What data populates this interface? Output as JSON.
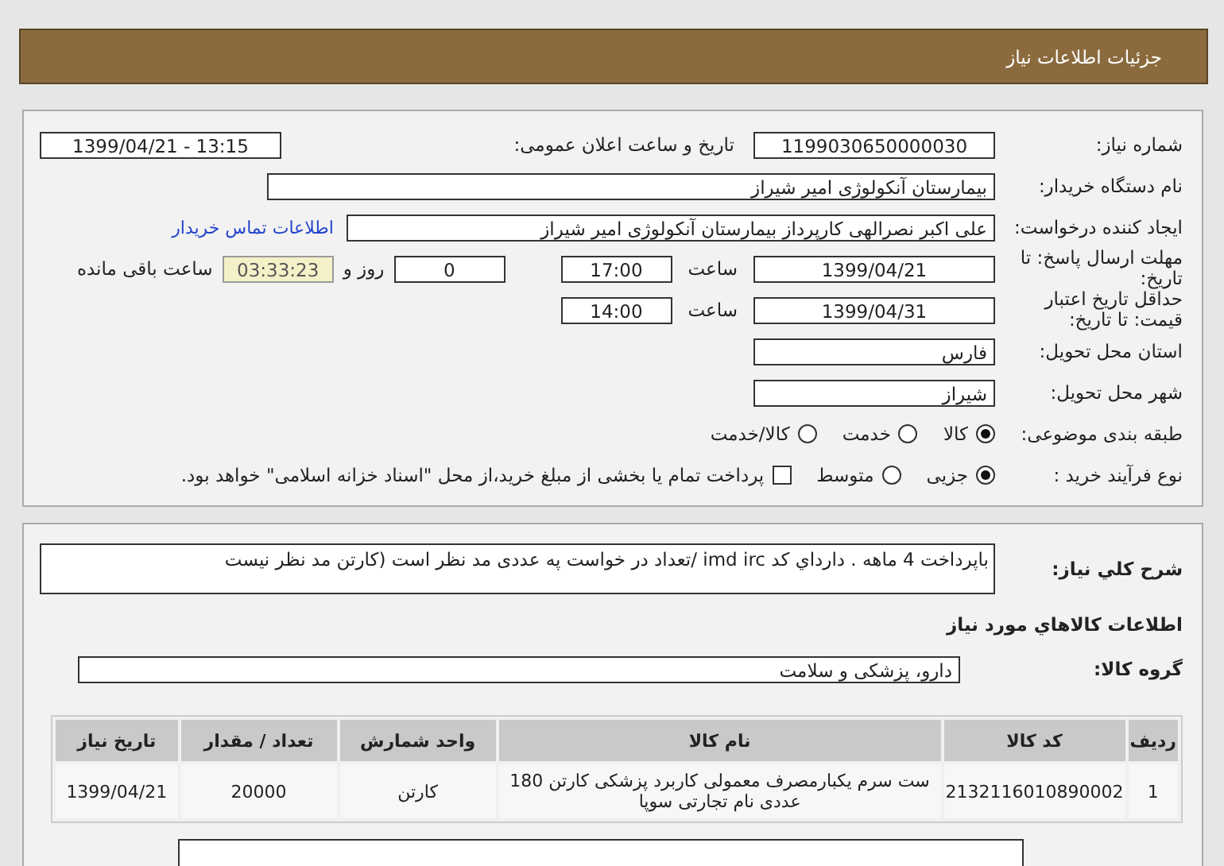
{
  "header": {
    "title": "جزئیات اطلاعات نیاز"
  },
  "need_number": {
    "label": "شماره نیاز:",
    "value": "1199030650000030"
  },
  "announce_datetime": {
    "label": "تاریخ و ساعت اعلان عمومی:",
    "value": "1399/04/21 - 13:15"
  },
  "buyer_org": {
    "label": "نام دستگاه خریدار:",
    "value": "بیمارستان آنکولوژی امیر شیراز"
  },
  "requester": {
    "label": "ایجاد کننده درخواست:",
    "value": "علی اکبر نصرالهی کارپرداز بیمارستان آنکولوژی امیر شیراز",
    "contact_link": "اطلاعات تماس خریدار"
  },
  "response_deadline": {
    "label": "مهلت ارسال پاسخ: تا تاریخ:",
    "date": "1399/04/21",
    "time_label": "ساعت",
    "time": "17:00",
    "days": "0",
    "days_label": "روز و",
    "remaining": "03:33:23",
    "remaining_label": "ساعت باقی مانده"
  },
  "price_validity": {
    "label": "حداقل تاریخ اعتبار قیمت: تا تاریخ:",
    "date": "1399/04/31",
    "time_label": "ساعت",
    "time": "14:00"
  },
  "province": {
    "label": "استان محل تحویل:",
    "value": "فارس"
  },
  "city": {
    "label": "شهر محل تحویل:",
    "value": "شیراز"
  },
  "category": {
    "label": "طبقه بندی موضوعی:",
    "options": [
      {
        "label": "کالا",
        "selected": true
      },
      {
        "label": "خدمت",
        "selected": false
      },
      {
        "label": "کالا/خدمت",
        "selected": false
      }
    ]
  },
  "purchase_process": {
    "label": "نوع فرآیند خرید :",
    "options": [
      {
        "label": "جزیی",
        "selected": true
      },
      {
        "label": "متوسط",
        "selected": false
      }
    ],
    "treasury": {
      "label": "پرداخت تمام یا بخشی از مبلغ خرید،از محل \"اسناد خزانه اسلامی\" خواهد بود.",
      "checked": false
    }
  },
  "description": {
    "label": "شرح کلي نیاز:",
    "value": "باپرداخت 4 ماهه . دارداي کد imd irc  /تعداد در خواست په عددی مد نظر است (کارتن مد نظر نیست"
  },
  "goods_heading": "اطلاعات کالاهاي مورد نیاز",
  "goods_group": {
    "label": "گروه کالا:",
    "value": "دارو، پزشکی و سلامت"
  },
  "table": {
    "columns": [
      "ردیف",
      "کد کالا",
      "نام کالا",
      "واحد شمارش",
      "تعداد / مقدار",
      "تاریخ نیاز"
    ],
    "rows": [
      [
        "1",
        "2132116010890002",
        "ست سرم یکبارمصرف معمولی کاربرد پزشکی کارتن 180 عددی نام تجارتی سوپا",
        "کارتن",
        "20000",
        "1399/04/21"
      ]
    ]
  }
}
